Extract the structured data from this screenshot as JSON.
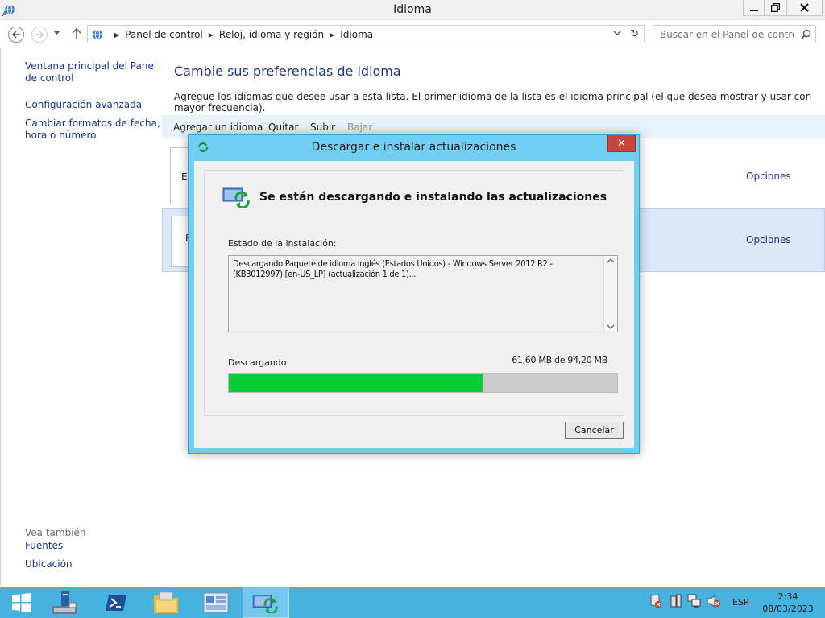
{
  "window": {
    "title": "Idioma"
  },
  "nav": {
    "breadcrumbs": [
      "Panel de control",
      "Reloj, idioma y región",
      "Idioma"
    ],
    "search_placeholder": "Buscar en el Panel de control"
  },
  "sidebar": {
    "links": [
      "Ventana principal del Panel de control",
      "Configuración avanzada",
      "Cambiar formatos de fecha, hora o número"
    ],
    "see_also_label": "Vea también",
    "see_also_links": [
      "Fuentes",
      "Ubicación"
    ]
  },
  "main": {
    "title": "Cambie sus preferencias de idioma",
    "description": "Agregue los idiomas que desee usar a esta lista. El primer idioma de la lista es el idioma principal (el que desea mostrar y usar con mayor frecuencia).",
    "toolbar": {
      "add": "Agregar un idioma",
      "remove": "Quitar",
      "up": "Subir",
      "down": "Bajar"
    },
    "language_rows": [
      {
        "letter": "E",
        "options": "Opciones"
      },
      {
        "letter": "E",
        "options": "Opciones"
      }
    ]
  },
  "dialog": {
    "title": "Descargar e instalar actualizaciones",
    "close": "✕",
    "heading": "Se están descargando e instalando las actualizaciones",
    "status_label": "Estado de la instalación:",
    "status_text": "Descargando Paquete de idioma inglés (Estados Unidos) - Windows Server 2012 R2 - (KB3012997) [en-US_LP] (actualización 1 de 1)...",
    "download_label": "Descargando:",
    "size_text": "61,60 MB de 94,20 MB",
    "progress_fraction": 0.654,
    "cancel": "Cancelar"
  },
  "taskbar": {
    "language": "ESP",
    "time": "2:34",
    "date": "08/03/2023"
  },
  "colors": {
    "taskbar": "#46b2e0",
    "dialog_frame": "#6fcef1",
    "progress_fill": "#06cc36",
    "link": "#1e3287"
  }
}
